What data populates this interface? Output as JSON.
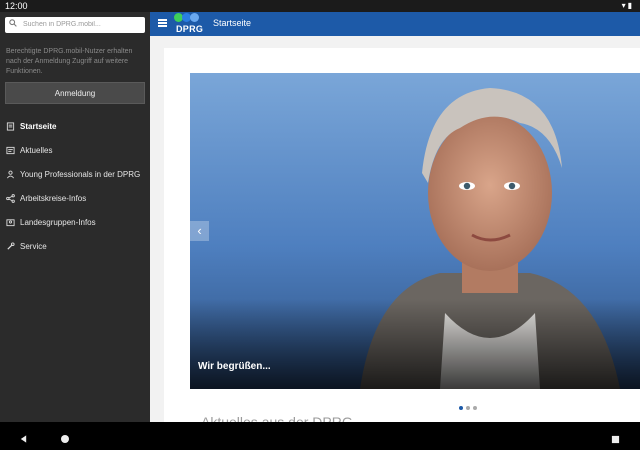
{
  "status_bar": {
    "time": "12:00"
  },
  "sidebar": {
    "search": {
      "placeholder": "Suchen in DPRG.mobil..."
    },
    "info_text": "Berechtigte DPRG.mobil-Nutzer erhalten nach der Anmeldung Zugriff auf weitere Funktionen.",
    "login_label": "Anmeldung",
    "items": [
      {
        "label": "Startseite",
        "icon": "home-icon",
        "active": true
      },
      {
        "label": "Aktuelles",
        "icon": "news-icon"
      },
      {
        "label": "Young Professionals in der DPRG",
        "icon": "people-icon"
      },
      {
        "label": "Arbeitskreise-Infos",
        "icon": "network-icon"
      },
      {
        "label": "Landesgruppen-Infos",
        "icon": "group-icon"
      },
      {
        "label": "Service",
        "icon": "tools-icon"
      }
    ]
  },
  "header": {
    "logo_text": "DPRG",
    "title": "Startseite",
    "logo_colors": [
      "#3ecf5a",
      "#2a7de1",
      "#6aa9f0"
    ],
    "accent": "#1d5aa8"
  },
  "main": {
    "hero": {
      "caption": "Wir begrüßen...",
      "current_slide": 1,
      "slide_count": 3
    },
    "section_title": "Aktuelles aus der DPRG"
  }
}
